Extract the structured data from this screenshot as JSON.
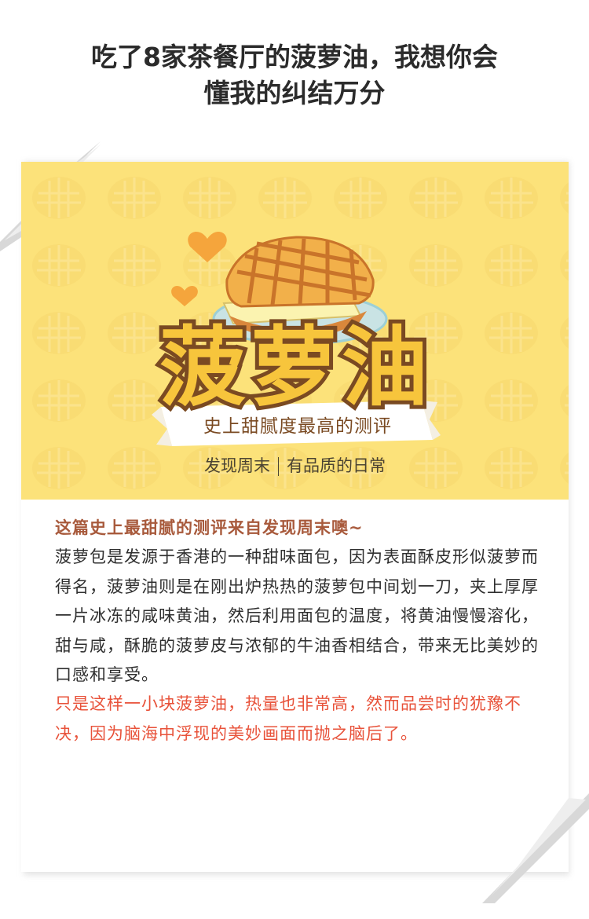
{
  "header": {
    "title_line1": "吃了8家茶餐厅的菠萝油，我想你会",
    "title_line2": "懂我的纠结万分"
  },
  "banner": {
    "title": "菠萝油",
    "subtitle": "史上甜腻度最高的测评",
    "tagline_left": "发现周末",
    "tagline_right": "有品质的日常",
    "colors": {
      "background": "#fce27a",
      "title": "#f7c53c",
      "heart": "#f5a53c"
    }
  },
  "content": {
    "lead": "这篇史上最甜腻的测评来自发现周末噢~",
    "body": "菠萝包是发源于香港的一种甜味面包，因为表面酥皮形似菠萝而得名，菠萝油则是在刚出炉热热的菠萝包中间划一刀，夹上厚厚一片冰冻的咸味黄油，然后利用面包的温度，将黄油慢慢溶化，甜与咸，酥脆的菠萝皮与浓郁的牛油香相结合，带来无比美妙的口感和享受。",
    "note": "只是这样一小块菠萝油，热量也非常高，然而品尝时的犹豫不决，因为脑海中浮现的美妙画面而抛之脑后了。",
    "colors": {
      "lead": "#a85a3c",
      "body": "#2f2f2f",
      "note": "#e8523a"
    }
  }
}
